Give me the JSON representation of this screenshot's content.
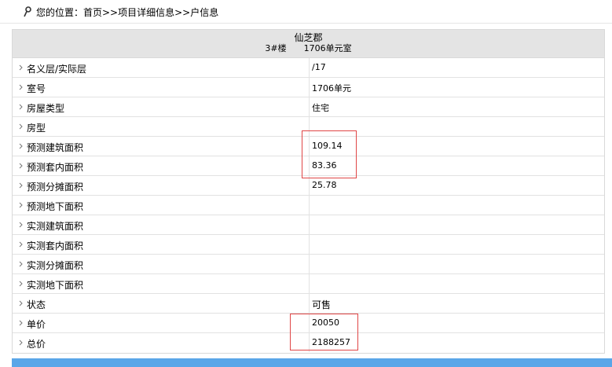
{
  "breadcrumb": {
    "icon": "pin-icon",
    "text": "您的位置：首页>>项目详细信息>>户信息"
  },
  "header": {
    "project_name": "仙芝郡",
    "building": "3#楼",
    "unit": "1706单元室"
  },
  "rows": [
    {
      "label": "名义层/实际层",
      "value": "/17"
    },
    {
      "label": "室号",
      "value": "1706单元"
    },
    {
      "label": "房屋类型",
      "value": "住宅"
    },
    {
      "label": "房型",
      "value": ""
    },
    {
      "label": "预测建筑面积",
      "value": "109.14"
    },
    {
      "label": "预测套内面积",
      "value": "83.36"
    },
    {
      "label": "预测分摊面积",
      "value": "25.78"
    },
    {
      "label": "预测地下面积",
      "value": ""
    },
    {
      "label": "实测建筑面积",
      "value": ""
    },
    {
      "label": "实测套内面积",
      "value": ""
    },
    {
      "label": "实测分摊面积",
      "value": ""
    },
    {
      "label": "实测地下面积",
      "value": ""
    },
    {
      "label": "状态",
      "value": "可售"
    },
    {
      "label": "单价",
      "value": "20050"
    },
    {
      "label": "总价",
      "value": "2188257"
    }
  ],
  "colors": {
    "header_bg": "#e4e4e4",
    "highlight": "#e04646",
    "bottom_bar": "#5aa6e8"
  }
}
